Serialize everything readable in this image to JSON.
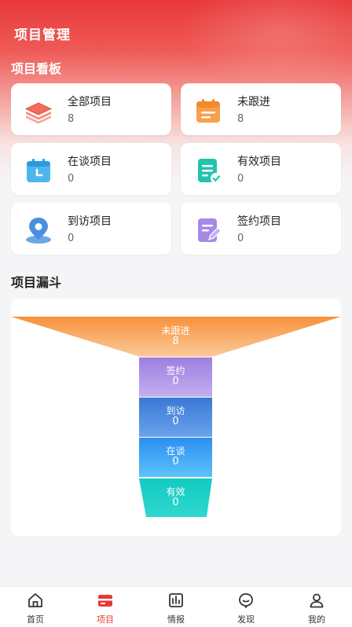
{
  "header": {
    "title": "项目管理"
  },
  "board": {
    "title": "项目看板",
    "cards": [
      {
        "label": "全部项目",
        "count": "8",
        "icon": "stack-layers-icon"
      },
      {
        "label": "未跟进",
        "count": "8",
        "icon": "calendar-icon"
      },
      {
        "label": "在谈项目",
        "count": "0",
        "icon": "calendar-blue-icon"
      },
      {
        "label": "有效项目",
        "count": "0",
        "icon": "document-check-icon"
      },
      {
        "label": "到访项目",
        "count": "0",
        "icon": "location-pin-icon"
      },
      {
        "label": "签约项目",
        "count": "0",
        "icon": "document-edit-icon"
      }
    ]
  },
  "funnel": {
    "title": "项目漏斗",
    "stages": [
      {
        "label": "未跟进",
        "value": "8"
      },
      {
        "label": "签约",
        "value": "0"
      },
      {
        "label": "到访",
        "value": "0"
      },
      {
        "label": "在谈",
        "value": "0"
      },
      {
        "label": "有效",
        "value": "0"
      }
    ]
  },
  "tabbar": {
    "items": [
      {
        "label": "首页",
        "icon": "home-icon"
      },
      {
        "label": "项目",
        "icon": "project-card-icon",
        "active": true
      },
      {
        "label": "情报",
        "icon": "intel-chart-icon"
      },
      {
        "label": "发现",
        "icon": "discover-chat-icon"
      },
      {
        "label": "我的",
        "icon": "user-icon"
      }
    ]
  },
  "colors": {
    "accent": "#e53935",
    "header_red": "#e8383a"
  }
}
